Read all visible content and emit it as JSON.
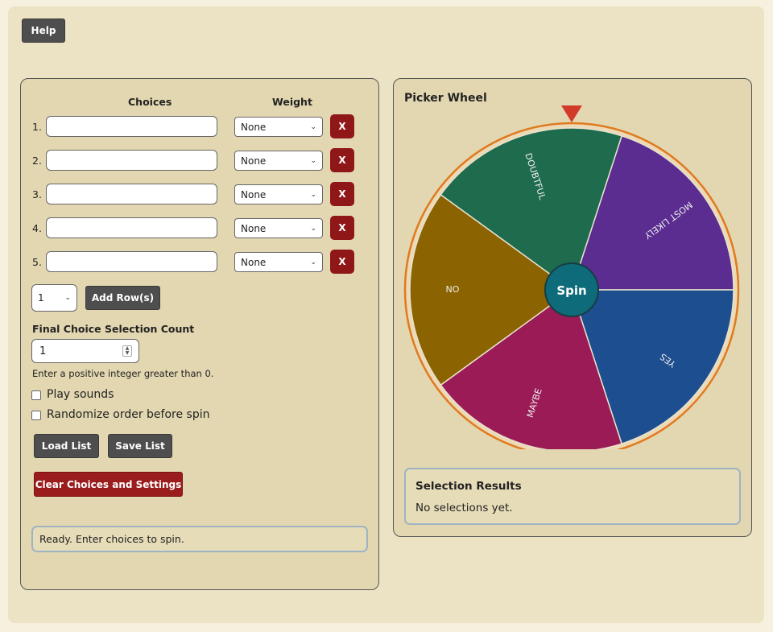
{
  "toolbar": {
    "help_label": "Help"
  },
  "choices_panel": {
    "choices_header": "Choices",
    "weight_header": "Weight",
    "rows": [
      {
        "num": "1.",
        "value": "",
        "weight": "None",
        "remove": "X"
      },
      {
        "num": "2.",
        "value": "",
        "weight": "None",
        "remove": "X"
      },
      {
        "num": "3.",
        "value": "",
        "weight": "None",
        "remove": "X"
      },
      {
        "num": "4.",
        "value": "",
        "weight": "None",
        "remove": "X"
      },
      {
        "num": "5.",
        "value": "",
        "weight": "None",
        "remove": "X"
      }
    ],
    "add_count": "1",
    "add_rows_label": "Add Row(s)",
    "final_count_label": "Final Choice Selection Count",
    "final_count_value": "1",
    "final_count_hint": "Enter a positive integer greater than 0.",
    "play_sounds_label": "Play sounds",
    "randomize_label": "Randomize order before spin",
    "load_list_label": "Load List",
    "save_list_label": "Save List",
    "clear_label": "Clear Choices and Settings",
    "status_text": "Ready. Enter choices to spin."
  },
  "wheel_panel": {
    "title": "Picker Wheel",
    "spin_label": "Spin",
    "segments": [
      {
        "label": "MOST LIKELY",
        "color": "#5b2d91"
      },
      {
        "label": "YES",
        "color": "#1d4e8f"
      },
      {
        "label": "MAYBE",
        "color": "#9b1b57"
      },
      {
        "label": "NO",
        "color": "#8b6300"
      },
      {
        "label": "DOUBTFUL",
        "color": "#1f6b4e"
      }
    ],
    "rim_color": "#e07a1f",
    "pointer_color": "#d23a2a",
    "hub_color": "#0e6b7a",
    "results_title": "Selection Results",
    "results_text": "No selections yet."
  }
}
